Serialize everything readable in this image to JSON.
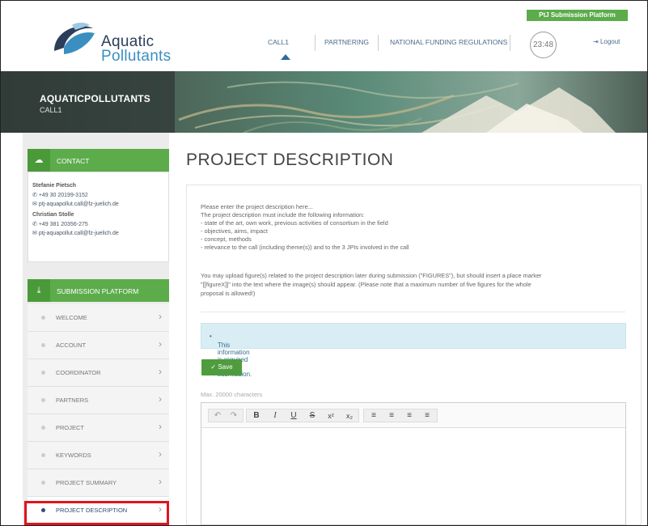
{
  "header": {
    "logo_line1": "Aquatic",
    "logo_line2": "Pollutants",
    "ptj_badge": "PtJ Submission Platform",
    "nav": [
      "CALL1",
      "PARTNERING",
      "NATIONAL FUNDING REGULATIONS"
    ],
    "timer": "23:48",
    "logout": "Logout",
    "logout_icon": "logout-icon"
  },
  "banner": {
    "title": "AQUATICPOLLUTANTS",
    "subtitle": "CALL1"
  },
  "contact": {
    "heading": "CONTACT",
    "icon": "contact-icon",
    "persons": [
      {
        "name": "Stefanie Pietsch",
        "phone": "+49 30 20199-3152",
        "email": "ptj-aquapollut.call@fz-juelich.de"
      },
      {
        "name": "Christian Stolle",
        "phone": "+49 381 20356-275",
        "email": "ptj-aquapollut.call@fz-juelich.de"
      }
    ]
  },
  "submission": {
    "heading": "SUBMISSION PLATFORM",
    "icon": "download-icon",
    "items": [
      {
        "label": "WELCOME",
        "active": false
      },
      {
        "label": "ACCOUNT",
        "active": false
      },
      {
        "label": "COORDINATOR",
        "active": false
      },
      {
        "label": "PARTNERS",
        "active": false
      },
      {
        "label": "PROJECT",
        "active": false
      },
      {
        "label": "KEYWORDS",
        "active": false
      },
      {
        "label": "PROJECT SUMMARY",
        "active": false
      },
      {
        "label": "PROJECT DESCRIPTION",
        "active": true
      }
    ]
  },
  "main": {
    "title": "PROJECT DESCRIPTION",
    "intro_lines": [
      "Please enter the project description here...",
      "The project description must include the following information:",
      "- state of the art, own work, previous activities of consortium in the field",
      "- objectives, aims, impact",
      "- concept, methods",
      "- relevance to the call (including theme(s)) and to the 3 JPIs involved in the call"
    ],
    "figure_lines": [
      "You may upload figure(s) related to the project description later during submission (\"FIGURES\"), but should insert a place marker",
      "\"[[figureX]]\" into the text where the image(s) should appear. (Please note that a maximum number of five figures for the whole",
      "proposal is allowed!)"
    ],
    "info": "This information is required for submission.",
    "save_label": "Save",
    "max_chars": "Max. 20000 characters"
  },
  "editor_toolbar": [
    {
      "icon": "undo-icon",
      "glyph": "↶"
    },
    {
      "icon": "redo-icon",
      "glyph": "↷"
    },
    {
      "icon": "bold-icon",
      "glyph": "B"
    },
    {
      "icon": "italic-icon",
      "glyph": "I"
    },
    {
      "icon": "underline-icon",
      "glyph": "U"
    },
    {
      "icon": "strikethrough-icon",
      "glyph": "S"
    },
    {
      "icon": "superscript-icon",
      "glyph": "x²"
    },
    {
      "icon": "subscript-icon",
      "glyph": "x₂"
    },
    {
      "icon": "align-left-icon",
      "glyph": "≡"
    },
    {
      "icon": "align-center-icon",
      "glyph": "≡"
    },
    {
      "icon": "align-right-icon",
      "glyph": "≡"
    },
    {
      "icon": "align-justify-icon",
      "glyph": "≡"
    }
  ],
  "colors": {
    "accent_green": "#5cac4b",
    "highlight_red": "#e0141e",
    "info_bg": "#d9edf5"
  }
}
